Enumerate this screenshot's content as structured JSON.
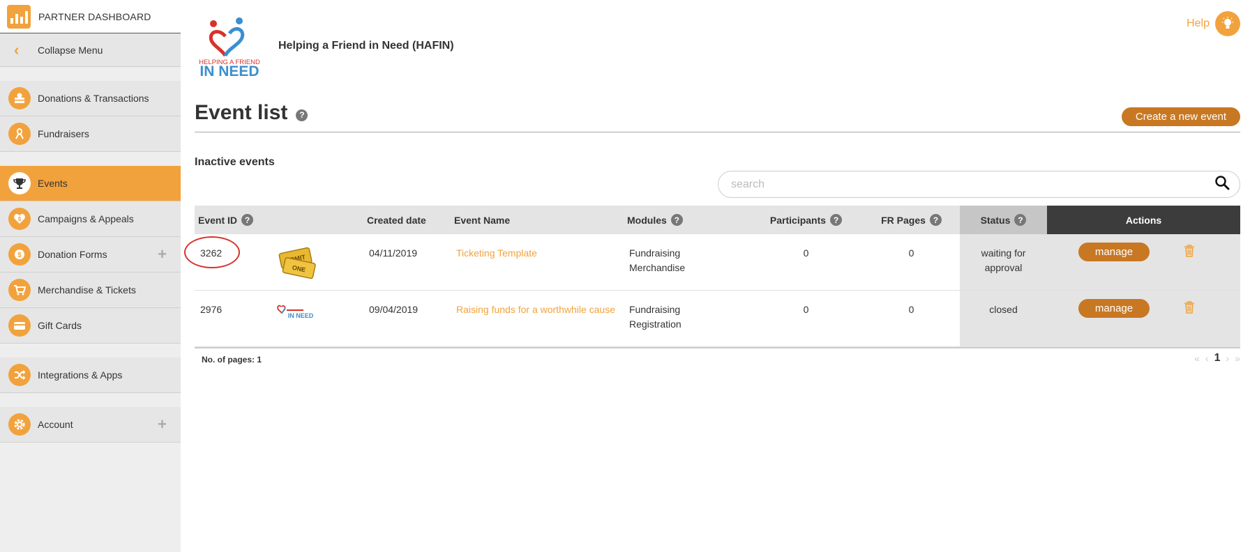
{
  "sidebar": {
    "header_label": "PARTNER DASHBOARD",
    "collapse_label": "Collapse Menu",
    "items": [
      {
        "label": "Donations & Transactions",
        "icon": "donation-box-icon"
      },
      {
        "label": "Fundraisers",
        "icon": "ribbon-icon"
      },
      {
        "label": "Events",
        "icon": "trophy-icon",
        "active": true
      },
      {
        "label": "Campaigns & Appeals",
        "icon": "heart-dollar-icon"
      },
      {
        "label": "Donation Forms",
        "icon": "coin-icon",
        "expandable": true
      },
      {
        "label": "Merchandise & Tickets",
        "icon": "cart-icon"
      },
      {
        "label": "Gift Cards",
        "icon": "card-icon"
      },
      {
        "label": "Integrations & Apps",
        "icon": "shuffle-icon"
      },
      {
        "label": "Account",
        "icon": "gear-icon",
        "expandable": true
      }
    ]
  },
  "header": {
    "org_logo_text_1": "HELPING A FRIEND",
    "org_logo_text_2": "IN NEED",
    "org_name": "Helping a Friend in Need (HAFIN)",
    "help_label": "Help"
  },
  "page": {
    "title": "Event list",
    "create_label": "Create a new event",
    "section_label": "Inactive events",
    "search_placeholder": "search"
  },
  "table": {
    "headers": {
      "event_id": "Event ID",
      "created_date": "Created date",
      "event_name": "Event Name",
      "modules": "Modules",
      "participants": "Participants",
      "fr_pages": "FR Pages",
      "status": "Status",
      "actions": "Actions"
    },
    "rows": [
      {
        "id": "3262",
        "image": "ticket-image",
        "ticket_text_1": "ADMIT",
        "ticket_text_2": "ONE",
        "created": "04/11/2019",
        "name": "Ticketing Template",
        "module_1": "Fundraising",
        "module_2": "Merchandise",
        "participants": "0",
        "fr_pages": "0",
        "status_1": "waiting for",
        "status_2": "approval",
        "action": "manage"
      },
      {
        "id": "2976",
        "image": "org-logo-image",
        "created": "09/04/2019",
        "name": "Raising funds for a worthwhile cause",
        "module_1": "Fundraising",
        "module_2": "Registration",
        "participants": "0",
        "fr_pages": "0",
        "status_1": "closed",
        "status_2": "",
        "action": "manage"
      }
    ]
  },
  "pagination": {
    "label": "No. of pages: 1",
    "first": "«",
    "prev": "‹",
    "current": "1",
    "next": "›",
    "last": "»"
  },
  "colors": {
    "accent": "#f2a23c",
    "button": "#c87822",
    "annotation": "#d8322a"
  }
}
